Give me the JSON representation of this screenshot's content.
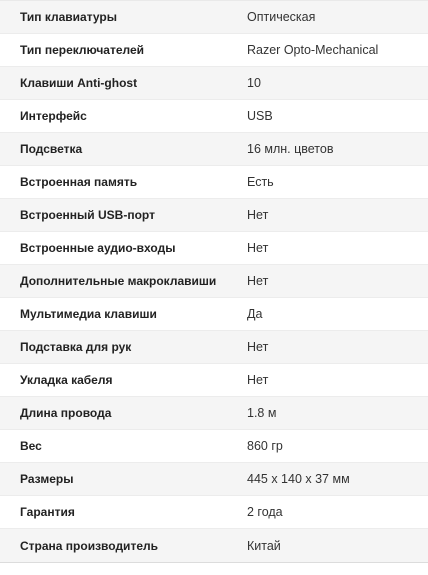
{
  "specs": {
    "rows": [
      {
        "label": "Тип клавиатуры",
        "value": "Оптическая"
      },
      {
        "label": "Тип переключателей",
        "value": "Razer Opto-Mechanical"
      },
      {
        "label": "Клавиши Anti-ghost",
        "value": "10"
      },
      {
        "label": "Интерфейс",
        "value": "USB"
      },
      {
        "label": "Подсветка",
        "value": "16 млн. цветов"
      },
      {
        "label": "Встроенная память",
        "value": "Есть"
      },
      {
        "label": "Встроенный USB-порт",
        "value": "Нет"
      },
      {
        "label": "Встроенные аудио-входы",
        "value": "Нет"
      },
      {
        "label": "Дополнительные макроклавиши",
        "value": "Нет"
      },
      {
        "label": "Мультимедиа клавиши",
        "value": "Да"
      },
      {
        "label": "Подставка для рук",
        "value": "Нет"
      },
      {
        "label": "Укладка кабеля",
        "value": "Нет"
      },
      {
        "label": "Длина провода",
        "value": "1.8 м"
      },
      {
        "label": "Вес",
        "value": "860 гр"
      },
      {
        "label": "Размеры",
        "value": "445 x 140 x 37 мм"
      },
      {
        "label": "Гарантия",
        "value": "2 года"
      },
      {
        "label": "Страна производитель",
        "value": "Китай"
      }
    ]
  }
}
